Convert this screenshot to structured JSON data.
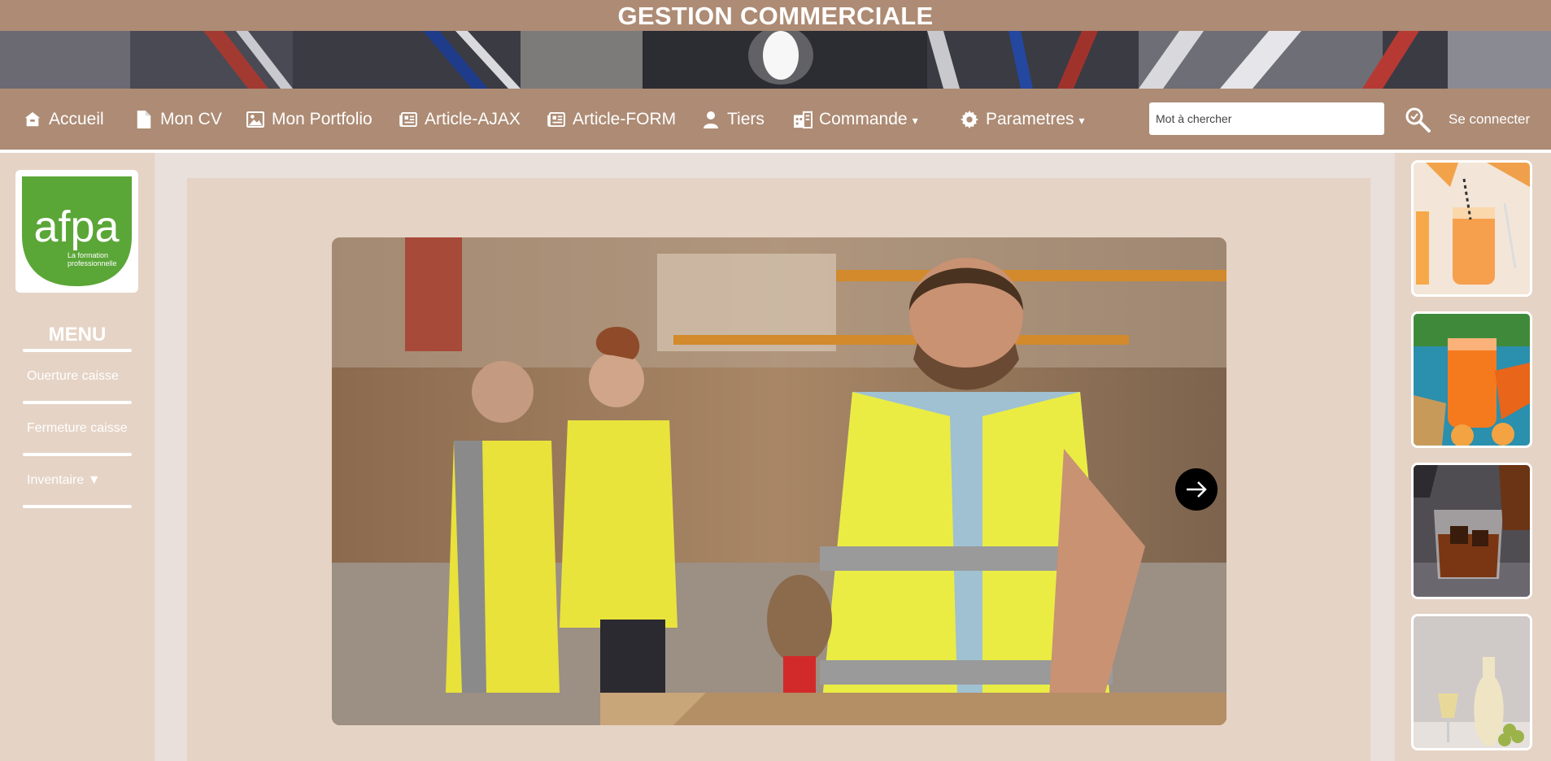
{
  "header": {
    "title": "GESTION COMMERCIALE"
  },
  "nav": {
    "items": [
      {
        "label": "Accueil",
        "icon": "home-icon"
      },
      {
        "label": "Mon CV",
        "icon": "document-icon"
      },
      {
        "label": "Mon Portfolio",
        "icon": "image-icon"
      },
      {
        "label": "Article-AJAX",
        "icon": "newspaper-icon"
      },
      {
        "label": "Article-FORM",
        "icon": "newspaper-icon"
      },
      {
        "label": "Tiers",
        "icon": "user-icon"
      },
      {
        "label": "Commande",
        "icon": "order-icon",
        "caret": "▾"
      },
      {
        "label": "Parametres",
        "icon": "gear-icon",
        "caret": "▾"
      }
    ],
    "search_placeholder": "Mot à chercher",
    "search_icon": "search-icon",
    "login_label": "Se connecter"
  },
  "sidebar": {
    "logo": {
      "text": "afpa",
      "tagline_1": "La formation",
      "tagline_2": "professionnelle"
    },
    "menu_title": "MENU",
    "items": [
      {
        "label": "Ouerture caisse"
      },
      {
        "label": "Fermeture caisse"
      },
      {
        "label": "Inventaire ▼"
      }
    ]
  },
  "carousel": {
    "next_icon": "arrow-right-icon"
  },
  "thumbnails": [
    {
      "subject": "orange-juice"
    },
    {
      "subject": "carrot-juice"
    },
    {
      "subject": "whiskey-glasses"
    },
    {
      "subject": "white-wine"
    }
  ],
  "colors": {
    "brand_brown": "#ad8b74",
    "panel_beige": "#e5d3c5",
    "page_bg": "#e9dfdb",
    "logo_green": "#5aa637"
  }
}
